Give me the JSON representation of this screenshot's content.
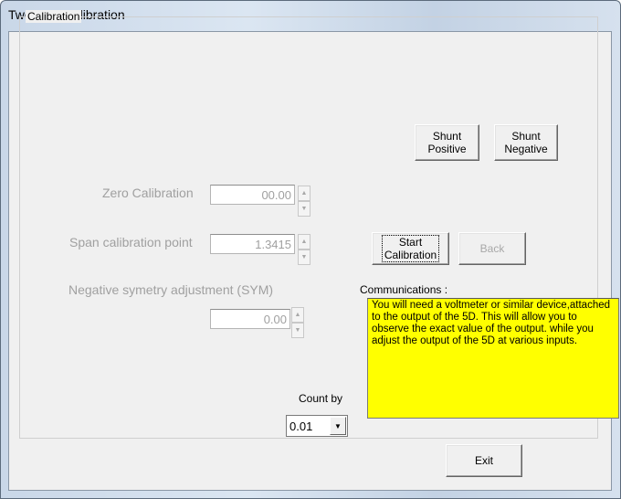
{
  "window": {
    "title": "Two point calibration"
  },
  "group": {
    "label": "Calibration"
  },
  "zero": {
    "label": "Zero Calibration",
    "value": "00.00"
  },
  "span": {
    "label": "Span calibration point",
    "value": "1.3415"
  },
  "sym": {
    "label": "Negative symetry adjustment  (SYM)",
    "value": "0.00"
  },
  "buttons": {
    "shunt_positive": "Shunt\nPositive",
    "shunt_negative": "Shunt\nNegative",
    "start_calibration": "Start\nCalibration",
    "back": "Back",
    "exit": "Exit"
  },
  "communications": {
    "label": "Communications :",
    "text": "You will need a voltmeter or similar device,attached to the output of the 5D. This will allow you to observe the exact value of the output. while you adjust the output of the 5D at various inputs."
  },
  "count_by": {
    "label": "Count by",
    "value": "0.01"
  },
  "icons": {
    "spin_up": "spin-up-arrow-icon",
    "spin_down": "spin-down-arrow-icon",
    "combo_arrow": "chevron-down-icon"
  }
}
